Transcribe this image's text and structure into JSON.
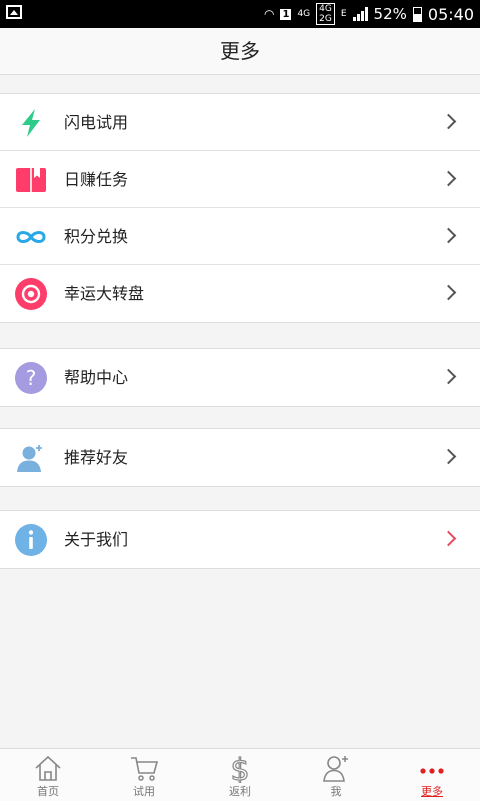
{
  "status": {
    "net": "4G",
    "net2": "4G",
    "sim": "2G",
    "edge": "E",
    "battery": "52%",
    "time": "05:40"
  },
  "header": {
    "title": "更多"
  },
  "menu": [
    {
      "label": "闪电试用",
      "icon": "lightning-icon",
      "color": "#2ecb8a"
    },
    {
      "label": "日赚任务",
      "icon": "book-icon",
      "color": "#ff3d6a"
    },
    {
      "label": "积分兑换",
      "icon": "infinity-icon",
      "color": "#29a8e8"
    },
    {
      "label": "幸运大转盘",
      "icon": "target-icon",
      "color": "#ff3d6a"
    },
    {
      "label": "帮助中心",
      "icon": "question-icon",
      "color": "#a59be0"
    },
    {
      "label": "推荐好友",
      "icon": "add-user-icon",
      "color": "#7ab0dd"
    },
    {
      "label": "关于我们",
      "icon": "info-icon",
      "color": "#6fb2e6"
    }
  ],
  "tabs": [
    {
      "label": "首页",
      "icon": "home-icon"
    },
    {
      "label": "试用",
      "icon": "cart-icon"
    },
    {
      "label": "返利",
      "icon": "dollar-icon"
    },
    {
      "label": "我",
      "icon": "user-icon"
    },
    {
      "label": "更多",
      "icon": "more-icon",
      "active": true
    }
  ],
  "colors": {
    "accent": "#e02020",
    "chevron_highlight": "#e84a5f"
  }
}
